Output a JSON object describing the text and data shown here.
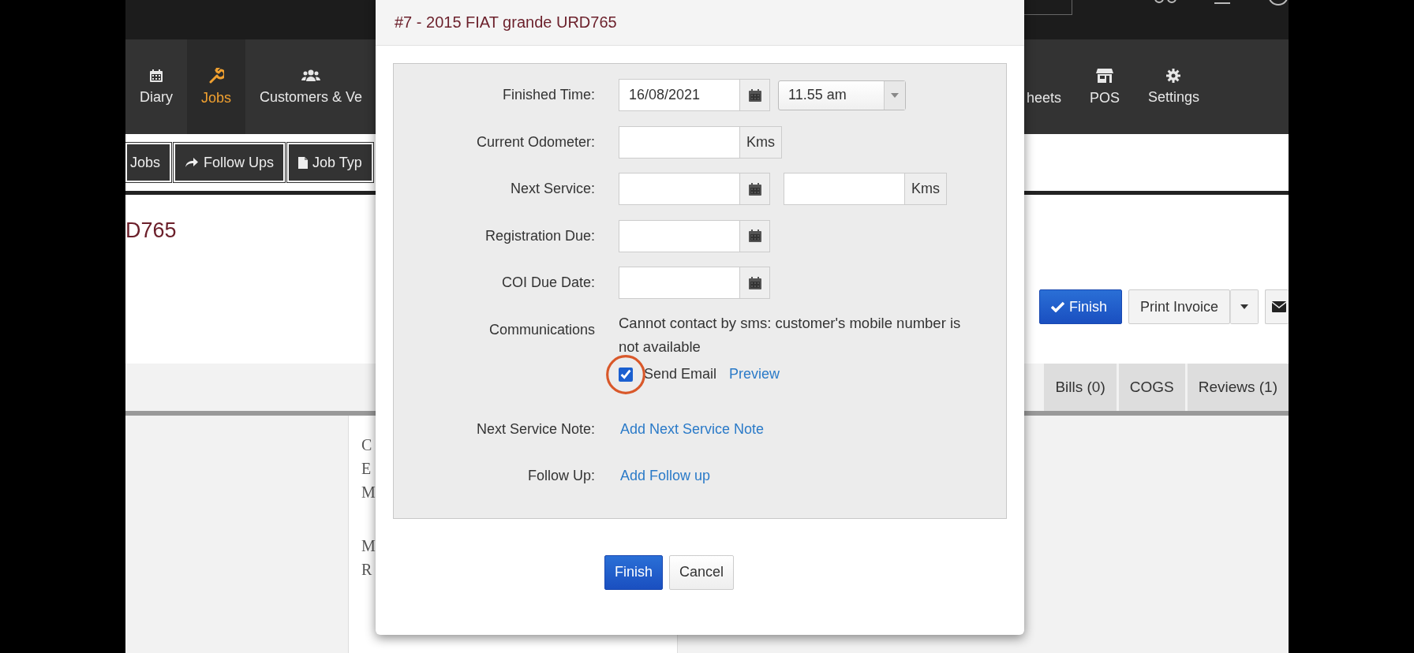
{
  "top_nav": {
    "items": [
      {
        "label": "Diary",
        "selected": false
      },
      {
        "label": "Jobs",
        "selected": true
      },
      {
        "label": "Customers & Ve",
        "selected": false
      },
      {
        "label": "heets",
        "selected": false
      },
      {
        "label": "POS",
        "selected": false
      },
      {
        "label": "Settings",
        "selected": false
      }
    ]
  },
  "sub_nav": [
    {
      "label": "Jobs",
      "selected": false
    },
    {
      "label": "Follow Ups",
      "selected": false
    },
    {
      "label": "Job Typ",
      "selected": false
    }
  ],
  "job_title": "D765",
  "actions": [
    {
      "label": "Finish",
      "kind": "primary"
    },
    {
      "label": "Print Invoice",
      "kind": "split"
    },
    {
      "kind": "mail"
    }
  ],
  "tabs": [
    {
      "label": "Bills (0)",
      "selected": false
    },
    {
      "label": "COGS",
      "selected": false
    },
    {
      "label": "Reviews (1)",
      "selected": false
    }
  ],
  "document_fragments": [
    "C",
    "E",
    "M",
    "M",
    "R"
  ],
  "modal": {
    "title": "#7 - 2015 FIAT grande URD765",
    "fields": [
      {
        "label": "Finished Time:",
        "kind": "datetime",
        "value": "16/08/2021",
        "time": "11.55 am"
      },
      {
        "label": "Current Odometer:",
        "kind": "distance",
        "unit": "Kms"
      },
      {
        "label": "Next Service:",
        "kind": "date_distance",
        "unit": "Kms"
      },
      {
        "label": "Registration Due:",
        "kind": "date"
      },
      {
        "label": "COI Due Date:",
        "kind": "date"
      },
      {
        "label": "Communications",
        "kind": "communications",
        "message": "Cannot contact by sms: customer's mobile number is not available",
        "checkbox": {
          "label": "Send Email",
          "checked": true
        },
        "link": "Preview"
      },
      {
        "label": "Next Service Note:",
        "kind": "link",
        "link": "Add Next Service Note"
      },
      {
        "label": "Follow Up:",
        "kind": "link",
        "link": "Add Follow up"
      }
    ],
    "buttons": [
      {
        "label": "Finish",
        "kind": "primary"
      },
      {
        "label": "Cancel",
        "kind": "default"
      }
    ]
  }
}
